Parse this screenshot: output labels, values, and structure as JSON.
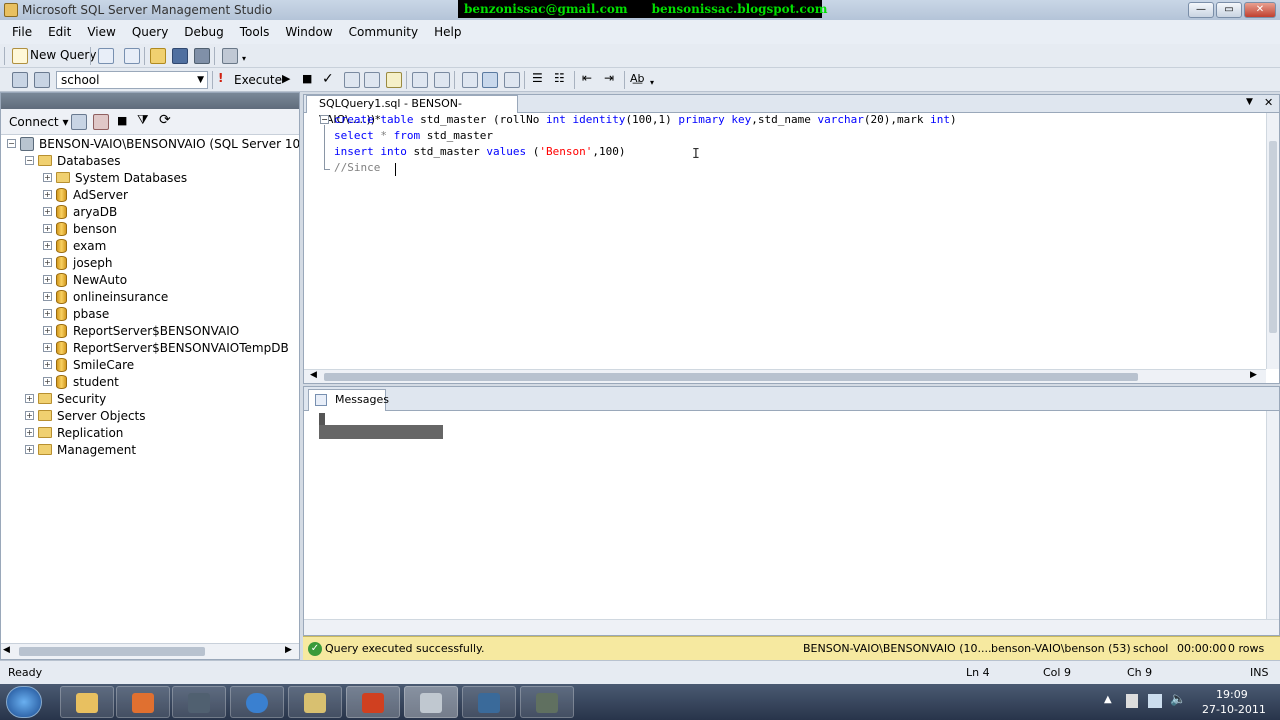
{
  "window": {
    "title": "Microsoft SQL Server Management Studio",
    "banner_email": "benzonissac@gmail.com",
    "banner_blog": "bensonissac.blogspot.com"
  },
  "menu": [
    "File",
    "Edit",
    "View",
    "Query",
    "Debug",
    "Tools",
    "Window",
    "Community",
    "Help"
  ],
  "toolbar": {
    "new_query": "New Query",
    "database": "school",
    "execute": "Execute"
  },
  "object_explorer": {
    "connect": "Connect",
    "server": "BENSON-VAIO\\BENSONVAIO (SQL Server 10.0.1600",
    "databases": "Databases",
    "db_items": [
      "System Databases",
      "AdServer",
      "aryaDB",
      "benson",
      "exam",
      "joseph",
      "NewAuto",
      "onlineinsurance",
      "pbase",
      "ReportServer$BENSONVAIO",
      "ReportServer$BENSONVAIOTempDB",
      "SmileCare",
      "student"
    ],
    "folders": [
      "Security",
      "Server Objects",
      "Replication",
      "Management"
    ]
  },
  "editor": {
    "tab": "SQLQuery1.sql - BENSON-VAIO\\.....))*",
    "lines": [
      "create table std_master (rollNo int identity(100,1) primary key,std_name varchar(20),mark int)",
      "select * from std_master",
      "insert into std_master values ('Benson',100)",
      "//Since "
    ]
  },
  "messages": {
    "tab": "Messages"
  },
  "query_status": {
    "message": "Query executed successfully.",
    "server": "BENSON-VAIO\\BENSONVAIO (10....",
    "login": "benson-VAIO\\benson (53)",
    "database": "school",
    "time": "00:00:00",
    "rows": "0 rows"
  },
  "statusbar": {
    "ready": "Ready",
    "ln": "Ln 4",
    "col": "Col 9",
    "ch": "Ch 9",
    "mode": "INS"
  },
  "taskbar": {
    "time": "19:09",
    "date": "27-10-2011"
  },
  "colors": {
    "status_yellow": "#f6e9a0",
    "banner_green": "#00e000",
    "sql_keyword": "#0000ff",
    "sql_string": "#ff0000",
    "sql_grey": "#808080"
  }
}
